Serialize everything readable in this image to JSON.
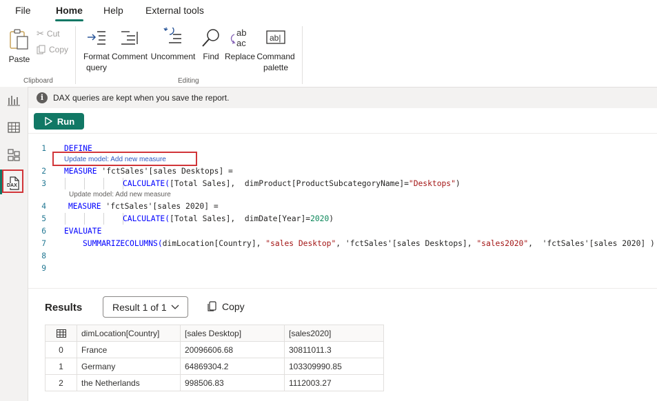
{
  "menu": {
    "file": "File",
    "home": "Home",
    "help": "Help",
    "external": "External tools"
  },
  "ribbon": {
    "paste": "Paste",
    "cut": "Cut",
    "copy": "Copy",
    "clipboard": "Clipboard",
    "format": "Format\nquery",
    "comment": "Comment",
    "uncomment": "Uncomment",
    "find": "Find",
    "replace": "Replace",
    "palette": "Command\npalette",
    "editing": "Editing"
  },
  "sidebar": {
    "dax_label": "DAX"
  },
  "info": {
    "text": "DAX queries are kept when you save the report."
  },
  "run": {
    "label": "Run"
  },
  "editor": {
    "line_numbers": [
      "1",
      "2",
      "3",
      "4",
      "5",
      "6",
      "7",
      "8",
      "9"
    ],
    "codelens_1": "Update model: Add new measure",
    "codelens_2": "Update model: Add new measure",
    "lines": {
      "l1_kw": "DEFINE",
      "l2_kw": "MEASURE",
      "l2_rest": " 'fctSales'[sales Desktops] =",
      "l3_fn": "CALCULATE(",
      "l3_a": "[Total Sales],  dimProduct[ProductSubcategoryName]=",
      "l3_str": "\"Desktops\"",
      "l3_b": ")",
      "l4_kw": "MEASURE",
      "l4_rest": " 'fctSales'[sales 2020] =",
      "l5_fn": "CALCULATE(",
      "l5_a": "[Total Sales],  dimDate[Year]=",
      "l5_num": "2020",
      "l5_b": ")",
      "l6_kw": "EVALUATE",
      "l7_fn": "SUMMARIZECOLUMNS(",
      "l7_a": "dimLocation[Country], ",
      "l7_s1": "\"sales Desktop\"",
      "l7_b": ", 'fctSales'[sales Desktops], ",
      "l7_s2": "\"sales2020\"",
      "l7_c": ",  'fctSales'[sales 2020] )"
    }
  },
  "results": {
    "title": "Results",
    "selector": "Result 1 of 1",
    "copy": "Copy",
    "columns": [
      "dimLocation[Country]",
      "[sales Desktop]",
      "[sales2020]"
    ],
    "rows": [
      [
        "0",
        "France",
        "20096606.68",
        "30811011.3"
      ],
      [
        "1",
        "Germany",
        "64869304.2",
        "103309990.85"
      ],
      [
        "2",
        "the Netherlands",
        "998506.83",
        "1112003.27"
      ]
    ]
  },
  "colors": {
    "accent": "#117865",
    "highlight": "#d13438",
    "keyword": "#0000ff",
    "string": "#a31515"
  }
}
